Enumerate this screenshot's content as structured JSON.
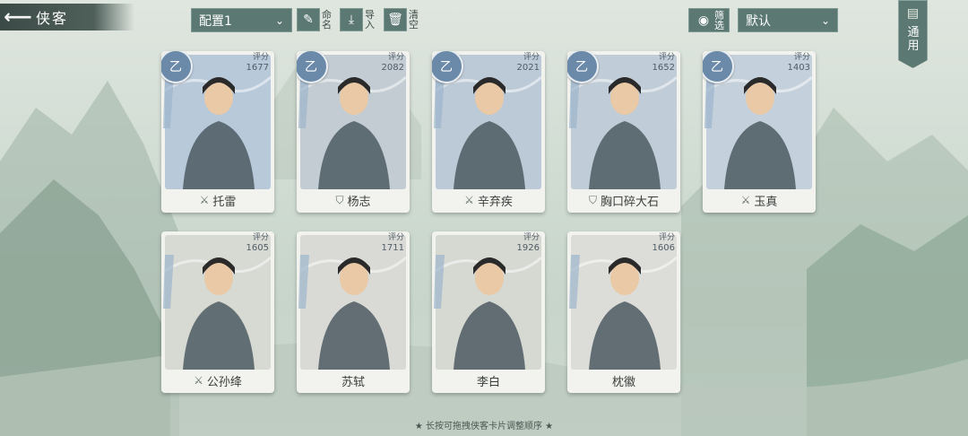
{
  "header": {
    "back_icon": "arrow-left-icon",
    "title": "侠客"
  },
  "toolbar": {
    "config_select": {
      "value": "配置1",
      "icon": "chevron-down-icon"
    },
    "rename": {
      "label": "命名",
      "icon": "brush-icon"
    },
    "import": {
      "label": "导入",
      "icon": "download-icon"
    },
    "clear": {
      "label": "清空",
      "icon": "trash-icon"
    },
    "filter": {
      "label": "筛选",
      "icon": "eye-icon"
    },
    "sort_select": {
      "value": "默认",
      "icon": "chevron-down-icon"
    },
    "general": {
      "label": "通用",
      "icon": "scroll-icon"
    }
  },
  "cards": [
    {
      "name": "托雷",
      "grade": "乙",
      "score_label": "评分",
      "score": "1677",
      "class_icon": "sword-icon",
      "bg": "#b8c9da"
    },
    {
      "name": "杨志",
      "grade": "乙",
      "score_label": "评分",
      "score": "2082",
      "class_icon": "shield-icon",
      "bg": "#c3ccd3"
    },
    {
      "name": "辛弃疾",
      "grade": "乙",
      "score_label": "评分",
      "score": "2021",
      "class_icon": "sword-icon",
      "bg": "#bccad8"
    },
    {
      "name": "胸口碎大石",
      "grade": "乙",
      "score_label": "评分",
      "score": "1652",
      "class_icon": "shield-icon",
      "bg": "#c0cdd8"
    },
    {
      "name": "玉真",
      "grade": "乙",
      "score_label": "评分",
      "score": "1403",
      "class_icon": "sword-icon",
      "bg": "#c4d1dc"
    },
    {
      "name": "公孙绛",
      "grade": "",
      "score_label": "评分",
      "score": "1605",
      "class_icon": "sword-icon",
      "bg": "#d7d9d3"
    },
    {
      "name": "苏轼",
      "grade": "",
      "score_label": "评分",
      "score": "1711",
      "class_icon": "",
      "bg": "#d9dad5"
    },
    {
      "name": "李白",
      "grade": "",
      "score_label": "评分",
      "score": "1926",
      "class_icon": "",
      "bg": "#d6d8d2"
    },
    {
      "name": "枕徽",
      "grade": "",
      "score_label": "评分",
      "score": "1606",
      "class_icon": "",
      "bg": "#dcdcd8"
    }
  ],
  "footer_tip": "★ 长按可拖拽侠客卡片调整顺序 ★",
  "colors": {
    "button_bg": "#5b7873",
    "grade_badge": "#6b89a8",
    "card_bg": "#f2f3ee"
  }
}
